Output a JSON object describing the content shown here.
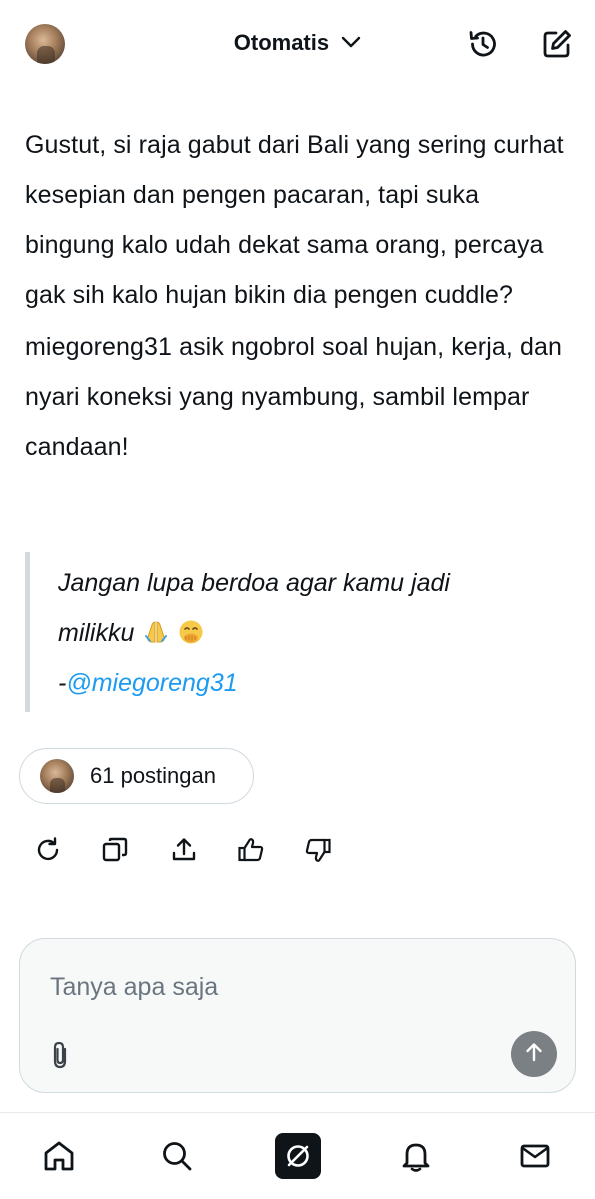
{
  "header": {
    "title": "Otomatis",
    "icons": [
      "avatar",
      "chevron-down-icon",
      "history-icon",
      "new-chat-icon"
    ]
  },
  "message": {
    "paragraph_1": "Gustut, si raja gabut dari Bali yang sering curhat kesepian dan pengen pacaran, tapi suka bingung kalo udah dekat sama orang, percaya gak sih kalo hujan bikin dia pengen cuddle?",
    "paragraph_2": "miegoreng31 asik ngobrol soal hujan, kerja, dan nyari koneksi yang nyambung, sambil lempar candaan!",
    "quote_line_1": "Jangan lupa berdoa agar kamu jadi",
    "quote_line_2": "milikku",
    "quote_emojis": [
      "folded-hands-emoji",
      "face-with-hand-over-mouth-emoji"
    ],
    "quote_prefix": "-",
    "quote_mention": "@miegoreng31"
  },
  "posts_pill": {
    "label": "61 postingan"
  },
  "actions": [
    "regenerate-icon",
    "copy-icon",
    "share-icon",
    "thumbs-up-icon",
    "thumbs-down-icon"
  ],
  "composer": {
    "placeholder": "Tanya apa saja",
    "attach_icon": "paperclip-icon",
    "send_icon": "arrow-up-icon"
  },
  "bottom_nav": [
    "home-icon",
    "search-icon",
    "grok-icon",
    "bell-icon",
    "mail-icon"
  ],
  "colors": {
    "text": "#0f1419",
    "mention": "#1d9bf0",
    "border": "#cfd9de",
    "placeholder": "#6b7580",
    "send_button": "#7b8085"
  }
}
